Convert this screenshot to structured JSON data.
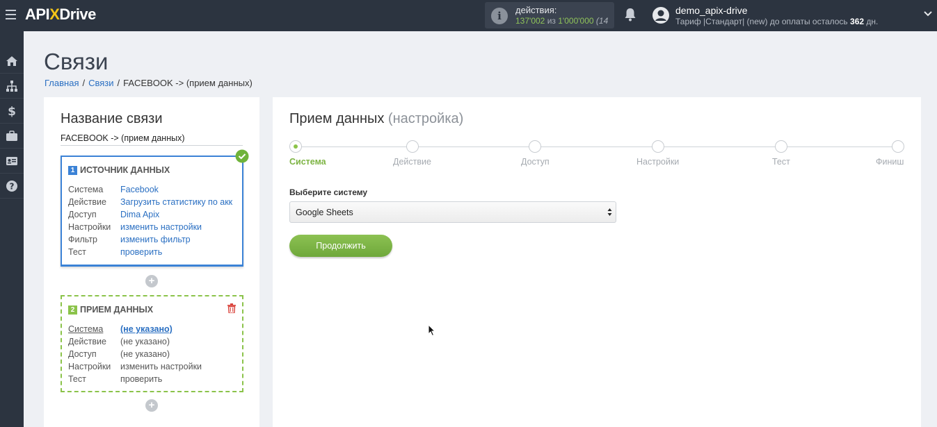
{
  "topbar": {
    "logo_left": "API",
    "logo_x": "X",
    "logo_right": "Drive",
    "actions_label": "действия:",
    "actions_used": "137'002",
    "actions_of": "из",
    "actions_total": "1'000'000",
    "actions_extra": "(14",
    "user_name": "demo_apix-drive",
    "plan_prefix": "Тариф |Стандарт| (new) до оплаты осталось",
    "plan_days": "362",
    "plan_suffix": "дн."
  },
  "sidebar": {
    "icons": [
      "home-icon",
      "sitemap-icon",
      "dollar-icon",
      "briefcase-icon",
      "id-card-icon",
      "help-icon"
    ]
  },
  "page": {
    "title": "Связи",
    "breadcrumb": {
      "home": "Главная",
      "links": "Связи",
      "current": "FACEBOOK -> (прием данных)"
    }
  },
  "left_panel": {
    "title": "Название связи",
    "connection_name": "FACEBOOK -> (прием данных)",
    "source": {
      "number": "1",
      "title": "ИСТОЧНИК ДАННЫХ",
      "rows": [
        {
          "key": "Система",
          "value": "Facebook"
        },
        {
          "key": "Действие",
          "value": "Загрузить статистику по акк"
        },
        {
          "key": "Доступ",
          "value": "Dima Apix"
        },
        {
          "key": "Настройки",
          "value": "изменить настройки"
        },
        {
          "key": "Фильтр",
          "value": "изменить фильтр"
        },
        {
          "key": "Тест",
          "value": "проверить"
        }
      ]
    },
    "destination": {
      "number": "2",
      "title": "ПРИЕМ ДАННЫХ",
      "rows": [
        {
          "key": "Система",
          "value": "(не указано)"
        },
        {
          "key": "Действие",
          "value": "(не указано)"
        },
        {
          "key": "Доступ",
          "value": "(не указано)"
        },
        {
          "key": "Настройки",
          "value": "изменить настройки"
        },
        {
          "key": "Тест",
          "value": "проверить"
        }
      ]
    },
    "plus": "+"
  },
  "right_panel": {
    "title": "Прием данных",
    "title_sub": "(настройка)",
    "steps": [
      "Система",
      "Действие",
      "Доступ",
      "Настройки",
      "Тест",
      "Финиш"
    ],
    "active_step": 0,
    "field_label": "Выберите систему",
    "select_value": "Google Sheets",
    "continue_label": "Продолжить"
  },
  "colors": {
    "topbar": "#2c3440",
    "accent_green": "#8bc34a",
    "accent_blue": "#3b82d6",
    "link": "#2a6fc2"
  }
}
